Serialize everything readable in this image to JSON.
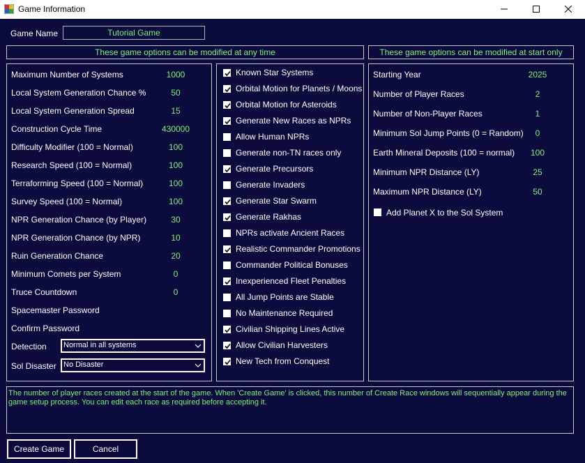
{
  "window": {
    "title": "Game Information"
  },
  "game_name": {
    "label": "Game Name",
    "value": "Tutorial Game"
  },
  "headers": {
    "any_time": "These game options can be modified at any time",
    "start_only": "These game options can be modified at start only"
  },
  "left_fields": [
    {
      "label": "Maximum Number of Systems",
      "value": "1000"
    },
    {
      "label": "Local System Generation Chance %",
      "value": "50"
    },
    {
      "label": "Local System Generation Spread",
      "value": "15"
    },
    {
      "label": "Construction Cycle Time",
      "value": "430000"
    },
    {
      "label": "Difficulty Modifier (100 = Normal)",
      "value": "100"
    },
    {
      "label": "Research Speed  (100 = Normal)",
      "value": "100"
    },
    {
      "label": "Terraforming Speed  (100 = Normal)",
      "value": "100"
    },
    {
      "label": "Survey Speed  (100 = Normal)",
      "value": "100"
    },
    {
      "label": "NPR Generation Chance (by Player)",
      "value": "30"
    },
    {
      "label": "NPR Generation Chance (by NPR)",
      "value": "10"
    },
    {
      "label": "Ruin Generation Chance",
      "value": "20"
    },
    {
      "label": "Minimum Comets per System",
      "value": "0"
    },
    {
      "label": "Truce Countdown",
      "value": "0"
    },
    {
      "label": "Spacemaster Password",
      "value": ""
    },
    {
      "label": "Confirm Password",
      "value": ""
    }
  ],
  "detection": {
    "label": "Detection",
    "value": "Normal in all systems"
  },
  "sol_disaster": {
    "label": "Sol Disaster",
    "value": "No Disaster"
  },
  "options": [
    {
      "label": "Known Star Systems",
      "checked": true
    },
    {
      "label": "Orbital Motion for Planets / Moons",
      "checked": true
    },
    {
      "label": "Orbital Motion for Asteroids",
      "checked": true
    },
    {
      "label": "Generate New Races as NPRs",
      "checked": true
    },
    {
      "label": "Allow Human NPRs",
      "checked": false
    },
    {
      "label": "Generate non-TN races only",
      "checked": false
    },
    {
      "label": "Generate Precursors",
      "checked": true
    },
    {
      "label": "Generate Invaders",
      "checked": false
    },
    {
      "label": "Generate Star Swarm",
      "checked": true
    },
    {
      "label": "Generate Rakhas",
      "checked": true
    },
    {
      "label": "NPRs activate Ancient Races",
      "checked": false
    },
    {
      "label": "Realistic Commander Promotions",
      "checked": true
    },
    {
      "label": "Commander Political Bonuses",
      "checked": false
    },
    {
      "label": "Inexperienced Fleet Penalties",
      "checked": true
    },
    {
      "label": "All Jump Points are Stable",
      "checked": false
    },
    {
      "label": "No Maintenance Required",
      "checked": false
    },
    {
      "label": "Civilian Shipping Lines Active",
      "checked": true
    },
    {
      "label": "Allow Civilian Harvesters",
      "checked": true
    },
    {
      "label": "New Tech from Conquest",
      "checked": true
    }
  ],
  "right_fields": [
    {
      "label": "Starting Year",
      "value": "2025"
    },
    {
      "label": "Number of Player Races",
      "value": "2"
    },
    {
      "label": "Number of Non-Player Races",
      "value": "1"
    },
    {
      "label": "Minimum Sol Jump Points (0 = Random)",
      "value": "0"
    },
    {
      "label": "Earth Mineral Deposits  (100 = normal)",
      "value": "100"
    },
    {
      "label": "Minimum NPR Distance (LY)",
      "value": "25"
    },
    {
      "label": "Maximum NPR Distance (LY)",
      "value": "50"
    }
  ],
  "planet_x": {
    "label": "Add Planet X to the Sol System",
    "checked": false
  },
  "description": "The number of player races created at the start of the game. When 'Create Game' is clicked, this number of Create Race windows will sequentially appear during the game setup process. You can edit each race as required before accepting it.",
  "buttons": {
    "create": "Create Game",
    "cancel": "Cancel"
  },
  "colors": {
    "background": "#0b0b3d",
    "value_text": "#7cf27c",
    "label_text": "#ffffff"
  },
  "icons": {
    "app": "app-icon",
    "minimize": "minimize-icon",
    "maximize": "maximize-icon",
    "close": "close-icon",
    "check": "checkmark-icon",
    "dropdown": "chevron-down-icon"
  }
}
